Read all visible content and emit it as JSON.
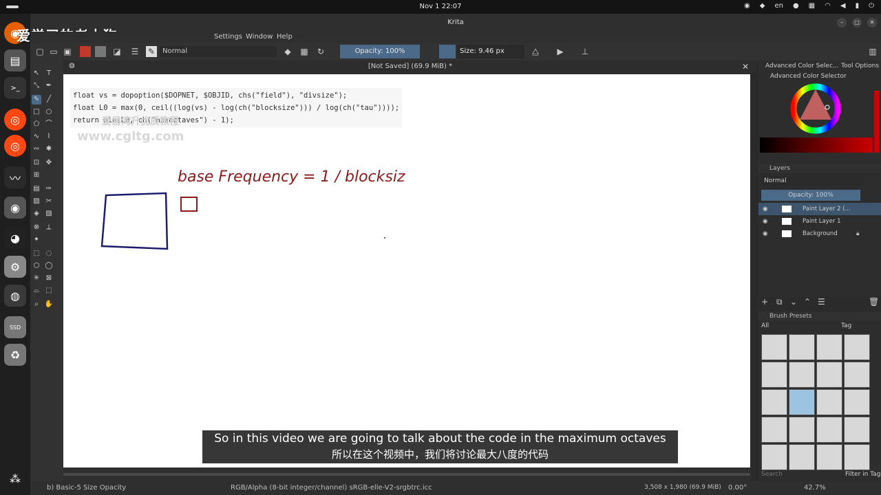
{
  "system": {
    "clock": "Nov 1  22:07",
    "lang": "en"
  },
  "window": {
    "title": "Krita",
    "doc_title": "[Not Saved]  (69.9 MiB) *"
  },
  "watermarks": {
    "top_cn": "爱学习的老土狗",
    "mid_cn": "爱易湾升优质教程",
    "site": "www.cgltg.com"
  },
  "menu": {
    "settings": "Settings",
    "window": "Window",
    "help": "Help"
  },
  "toolbar": {
    "blend_mode": "Normal",
    "opacity": "Opacity: 100%",
    "size": "Size: 9.46 px"
  },
  "canvas": {
    "code_lines": [
      "float vs = dopoption($DOPNET, $OBJID, chs(\"field\"), \"divsize\");",
      "float L0 = max(0, ceil((log(vs) - log(ch(\"blocksize\"))) / log(ch(\"tau\"))));",
      "return min(L0, ch(\"maxoctaves\") - 1);"
    ],
    "handwriting": "base Frequency = 1 / blocksiz"
  },
  "right_panels": {
    "color_tab1": "Advanced Color Selec...",
    "color_tab2": "Tool Options",
    "color_header": "Advanced Color Selector",
    "layers_header": "Layers",
    "layers_blend": "Normal",
    "layers_opacity": "Opacity:  100%",
    "layers": [
      {
        "name": "Paint Layer 2 (..."
      },
      {
        "name": "Paint Layer 1"
      },
      {
        "name": "Background"
      }
    ],
    "brush_header": "Brush Presets",
    "brush_filter": "All",
    "brush_tag": "Tag",
    "brush_search": "Search",
    "filter_in_tag": "Filter in Tag"
  },
  "subtitles": {
    "en": "So in this video we are going to talk about the code in the maximum octaves",
    "cn": "所以在这个视频中，我们将讨论最大八度的代码"
  },
  "status": {
    "brush": "b) Basic-5 Size Opacity",
    "color_space": "RGB/Alpha (8-bit integer/channel)  sRGB-elle-V2-srgbtrc.icc",
    "dims": "3,508 x 1,980 (69.9 MiB)",
    "rotation": "0.00°",
    "zoom": "42.7%"
  },
  "colors": {
    "accent": "#4b6a8a",
    "ink_red": "#8b1a1a",
    "ink_blue": "#1c1c6e"
  }
}
